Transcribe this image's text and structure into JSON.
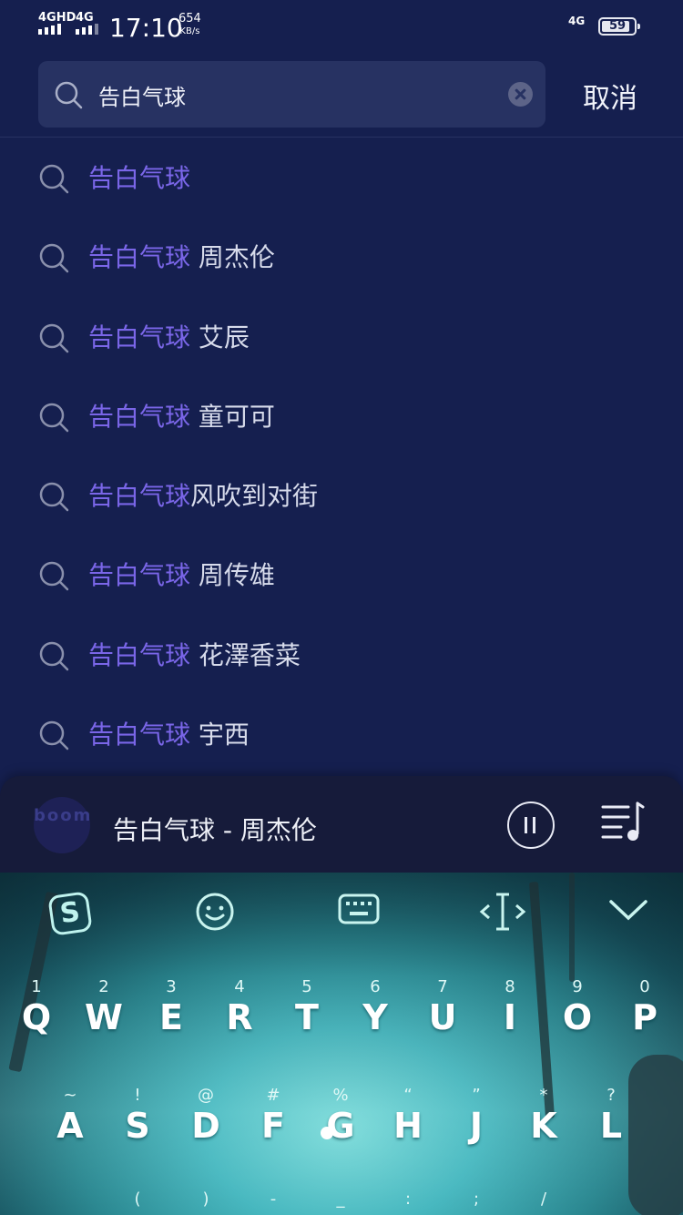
{
  "status_bar": {
    "net1": "4GHD",
    "net2": "4G",
    "time": "17:10",
    "speed_value": "654",
    "speed_unit": "KB/s",
    "net_right": "4G",
    "battery": "59"
  },
  "search": {
    "query": "告白气球",
    "cancel_label": "取消"
  },
  "suggestions": [
    {
      "keyword": "告白气球",
      "rest": ""
    },
    {
      "keyword": "告白气球",
      "rest": " 周杰伦"
    },
    {
      "keyword": "告白气球",
      "rest": " 艾辰"
    },
    {
      "keyword": "告白气球",
      "rest": " 童可可"
    },
    {
      "keyword": "告白气球",
      "rest": "风吹到对街"
    },
    {
      "keyword": "告白气球",
      "rest": " 周传雄"
    },
    {
      "keyword": "告白气球",
      "rest": " 花澤香菜"
    },
    {
      "keyword": "告白气球",
      "rest": " 宇西"
    }
  ],
  "player": {
    "album_logo": "boom",
    "track_title": "告白气球 - 周杰伦"
  },
  "keyboard": {
    "logo": "S",
    "row1": [
      {
        "num": "1",
        "ch": "Q"
      },
      {
        "num": "2",
        "ch": "W"
      },
      {
        "num": "3",
        "ch": "E"
      },
      {
        "num": "4",
        "ch": "R"
      },
      {
        "num": "5",
        "ch": "T"
      },
      {
        "num": "6",
        "ch": "Y"
      },
      {
        "num": "7",
        "ch": "U"
      },
      {
        "num": "8",
        "ch": "I"
      },
      {
        "num": "9",
        "ch": "O"
      },
      {
        "num": "0",
        "ch": "P"
      }
    ],
    "row2": [
      {
        "num": "~",
        "ch": "A"
      },
      {
        "num": "!",
        "ch": "S"
      },
      {
        "num": "@",
        "ch": "D"
      },
      {
        "num": "#",
        "ch": "F"
      },
      {
        "num": "%",
        "ch": "G"
      },
      {
        "num": "“",
        "ch": "H"
      },
      {
        "num": "”",
        "ch": "J"
      },
      {
        "num": "*",
        "ch": "K"
      },
      {
        "num": "?",
        "ch": "L"
      }
    ],
    "row3_symbols": [
      "(",
      ")",
      "-",
      "_",
      ":",
      ";",
      "/"
    ]
  }
}
